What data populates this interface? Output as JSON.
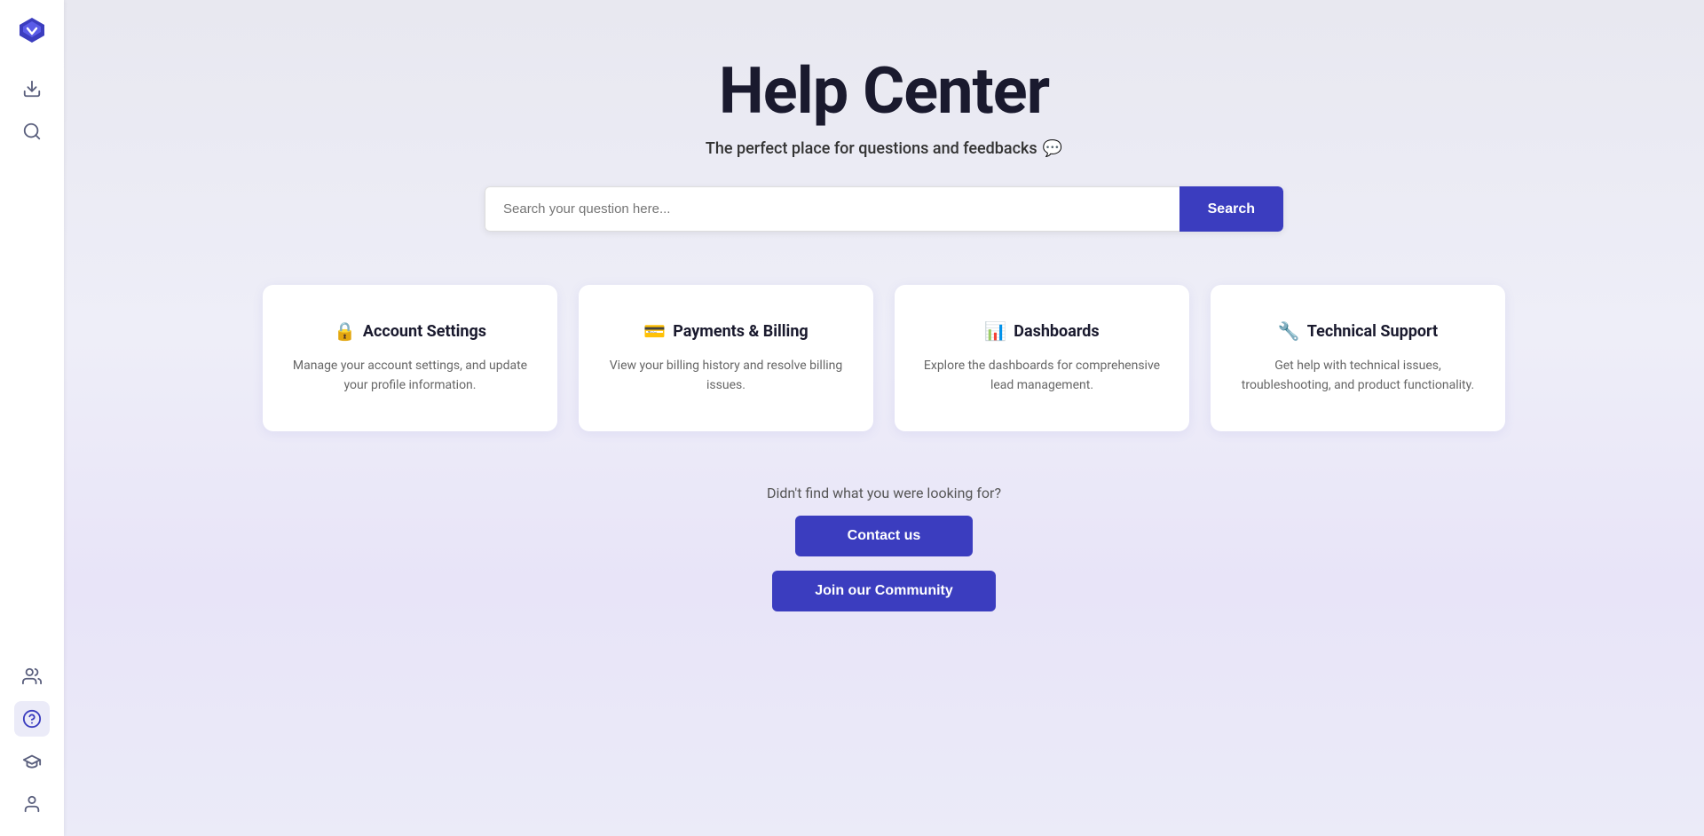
{
  "sidebar": {
    "logo_label": "Vendasta Logo",
    "items": [
      {
        "name": "download-icon",
        "label": "Download",
        "icon": "⬇",
        "active": false
      },
      {
        "name": "search-icon",
        "label": "Search",
        "icon": "🔍",
        "active": false
      },
      {
        "name": "team-icon",
        "label": "Team",
        "icon": "👥",
        "active": false
      },
      {
        "name": "help-icon",
        "label": "Help",
        "icon": "?",
        "active": true
      },
      {
        "name": "academy-icon",
        "label": "Academy",
        "icon": "🎓",
        "active": false
      },
      {
        "name": "profile-icon",
        "label": "Profile",
        "icon": "👤",
        "active": false
      }
    ]
  },
  "hero": {
    "title": "Help Center",
    "subtitle": "The perfect place for questions and feedbacks",
    "subtitle_icon": "💬"
  },
  "search": {
    "placeholder": "Search your question here...",
    "button_label": "Search"
  },
  "cards": [
    {
      "icon": "🔒",
      "title": "Account Settings",
      "description": "Manage your account settings, and update your profile information."
    },
    {
      "icon": "💳",
      "title": "Payments & Billing",
      "description": "View your billing history and resolve billing issues."
    },
    {
      "icon": "📊",
      "title": "Dashboards",
      "description": "Explore the dashboards for comprehensive lead management."
    },
    {
      "icon": "🔧",
      "title": "Technical Support",
      "description": "Get help with technical issues, troubleshooting, and product functionality."
    }
  ],
  "footer": {
    "not_found_text": "Didn't find what you were looking for?",
    "contact_label": "Contact us",
    "community_label": "Join our Community"
  }
}
